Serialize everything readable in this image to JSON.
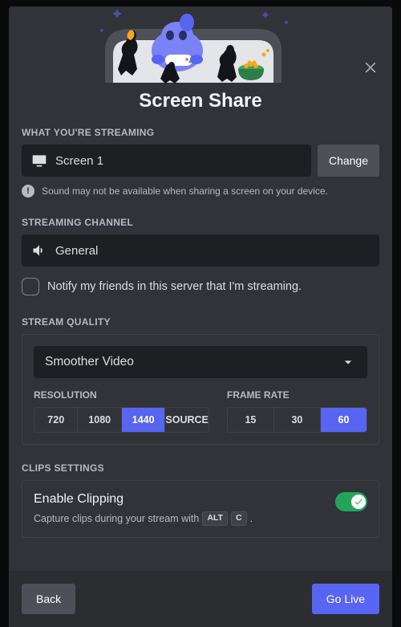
{
  "title": "Screen Share",
  "sections": {
    "streaming_label": "WHAT YOU'RE STREAMING",
    "source_name": "Screen 1",
    "change_label": "Change",
    "sound_warning": "Sound may not be available when sharing a screen on your device.",
    "channel_label": "STREAMING CHANNEL",
    "channel_name": "General",
    "notify_label": "Notify my friends in this server that I'm streaming.",
    "quality_label": "STREAM QUALITY",
    "quality_preset": "Smoother Video",
    "resolution_label": "RESOLUTION",
    "resolution_options": [
      "720",
      "1080",
      "1440",
      "SOURCE"
    ],
    "resolution_selected": "1440",
    "framerate_label": "FRAME RATE",
    "framerate_options": [
      "15",
      "30",
      "60"
    ],
    "framerate_selected": "60",
    "clips_label": "CLIPS SETTINGS",
    "clips_title": "Enable Clipping",
    "clips_desc": "Capture clips during your stream with",
    "clips_key1": "ALT",
    "clips_key2": "C",
    "clips_trailing": ".",
    "clips_enabled": true
  },
  "footer": {
    "back": "Back",
    "go_live": "Go Live"
  }
}
